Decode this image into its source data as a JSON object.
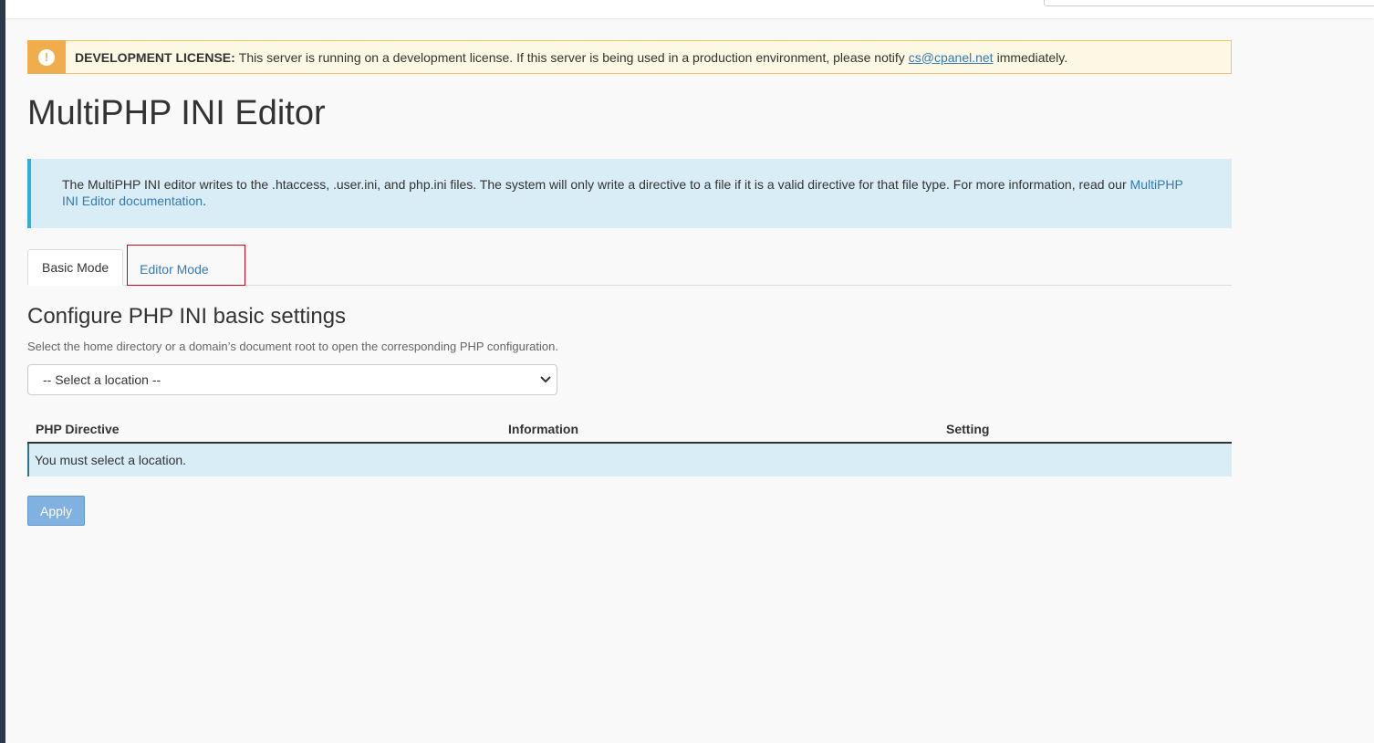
{
  "alert": {
    "label": "DEVELOPMENT LICENSE:",
    "message": "This server is running on a development license. If this server is being used in a production environment, please notify",
    "link": "cs@cpanel.net",
    "suffix": "immediately.",
    "icon": "exclamation-icon"
  },
  "page": {
    "title": "MultiPHP INI Editor"
  },
  "info": {
    "text": "The MultiPHP INI editor writes to the .htaccess, .user.ini, and php.ini files. The system will only write a directive to a file if it is a valid directive for that file type. For more information, read our",
    "link": "MultiPHP INI Editor documentation",
    "suffix": "."
  },
  "tabs": [
    {
      "label": "Basic Mode",
      "active": true
    },
    {
      "label": "Editor Mode",
      "active": false
    }
  ],
  "section": {
    "title": "Configure PHP INI basic settings",
    "help": "Select the home directory or a domain’s document root to open the corresponding PHP configuration."
  },
  "location_select": {
    "value": "-- Select a location --"
  },
  "table": {
    "headers": [
      "PHP Directive",
      "Information",
      "Setting"
    ],
    "empty_message": "You must select a location."
  },
  "actions": {
    "apply_label": "Apply"
  },
  "colors": {
    "warning_accent": "#f0ad4e",
    "info_bg": "#d9edf7",
    "link": "#337ab7",
    "highlight": "#d0021b",
    "apply_bg": "#7aaee0"
  }
}
